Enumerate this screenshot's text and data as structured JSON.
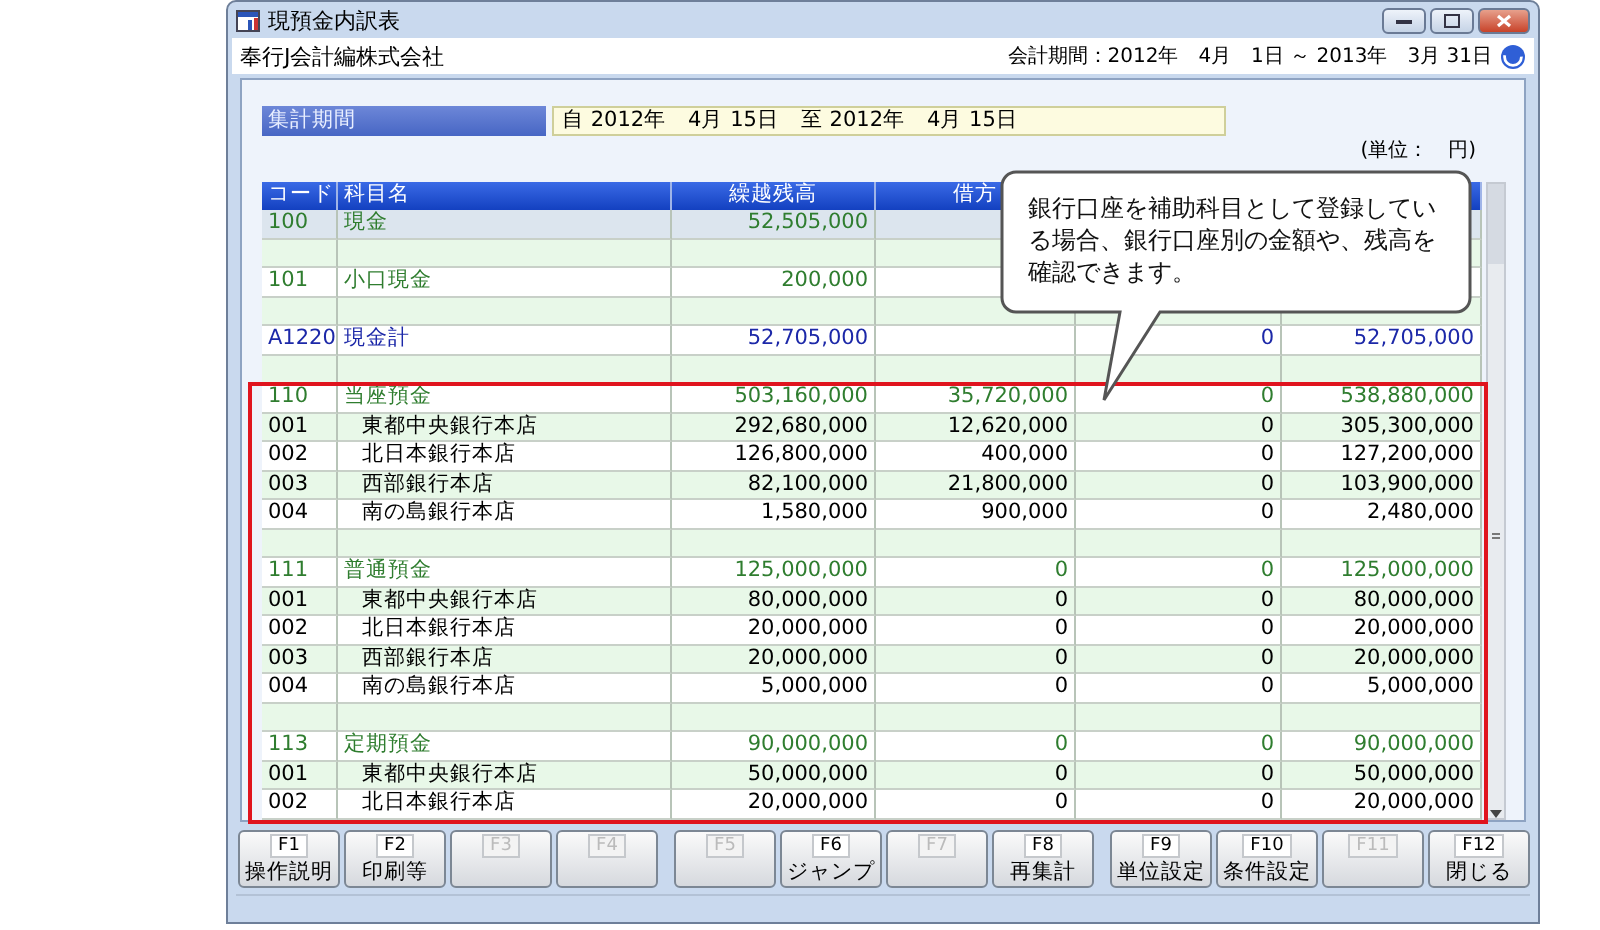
{
  "window": {
    "title": "現預金内訳表",
    "company": "奉行J会計編株式会社",
    "fiscal_period": "会計期間：2012年　4月　1日 ～ 2013年　3月 31日"
  },
  "period": {
    "label": "集計期間",
    "value": "自 2012年　4月 15日　至 2012年　4月 15日"
  },
  "unit": "(単位：　円)",
  "table": {
    "columns": [
      "コード",
      "科目名",
      "繰越残高",
      "借方"
    ],
    "rows": [
      {
        "kind": "group",
        "selected": true,
        "code": "100",
        "name": "現金",
        "carried": "52,505,000"
      },
      {
        "kind": "blank",
        "selected": false
      },
      {
        "kind": "group",
        "selected": false,
        "code": "101",
        "name": "小口現金",
        "carried": "200,000"
      },
      {
        "kind": "blank",
        "selected": false
      },
      {
        "kind": "total",
        "selected": false,
        "code": "A1220",
        "name": "現金計",
        "carried": "52,705,000",
        "credit": "0",
        "balance": "52,705,000"
      },
      {
        "kind": "blank",
        "selected": false
      },
      {
        "kind": "group",
        "selected": false,
        "code": "110",
        "name": "当座預金",
        "carried": "503,160,000",
        "debit": "35,720,000",
        "credit": "0",
        "balance": "538,880,000"
      },
      {
        "kind": "detail",
        "selected": false,
        "code": "001",
        "name": "東都中央銀行本店",
        "carried": "292,680,000",
        "debit": "12,620,000",
        "credit": "0",
        "balance": "305,300,000"
      },
      {
        "kind": "detail",
        "selected": false,
        "code": "002",
        "name": "北日本銀行本店",
        "carried": "126,800,000",
        "debit": "400,000",
        "credit": "0",
        "balance": "127,200,000"
      },
      {
        "kind": "detail",
        "selected": false,
        "code": "003",
        "name": "西部銀行本店",
        "carried": "82,100,000",
        "debit": "21,800,000",
        "credit": "0",
        "balance": "103,900,000"
      },
      {
        "kind": "detail",
        "selected": false,
        "code": "004",
        "name": "南の島銀行本店",
        "carried": "1,580,000",
        "debit": "900,000",
        "credit": "0",
        "balance": "2,480,000"
      },
      {
        "kind": "blank",
        "selected": false
      },
      {
        "kind": "group",
        "selected": false,
        "code": "111",
        "name": "普通預金",
        "carried": "125,000,000",
        "debit": "0",
        "credit": "0",
        "balance": "125,000,000"
      },
      {
        "kind": "detail",
        "selected": false,
        "code": "001",
        "name": "東都中央銀行本店",
        "carried": "80,000,000",
        "debit": "0",
        "credit": "0",
        "balance": "80,000,000"
      },
      {
        "kind": "detail",
        "selected": false,
        "code": "002",
        "name": "北日本銀行本店",
        "carried": "20,000,000",
        "debit": "0",
        "credit": "0",
        "balance": "20,000,000"
      },
      {
        "kind": "detail",
        "selected": false,
        "code": "003",
        "name": "西部銀行本店",
        "carried": "20,000,000",
        "debit": "0",
        "credit": "0",
        "balance": "20,000,000"
      },
      {
        "kind": "detail",
        "selected": false,
        "code": "004",
        "name": "南の島銀行本店",
        "carried": "5,000,000",
        "debit": "0",
        "credit": "0",
        "balance": "5,000,000"
      },
      {
        "kind": "blank",
        "selected": false
      },
      {
        "kind": "group",
        "selected": false,
        "code": "113",
        "name": "定期預金",
        "carried": "90,000,000",
        "debit": "0",
        "credit": "0",
        "balance": "90,000,000"
      },
      {
        "kind": "detail",
        "selected": false,
        "code": "001",
        "name": "東都中央銀行本店",
        "carried": "50,000,000",
        "debit": "0",
        "credit": "0",
        "balance": "50,000,000"
      },
      {
        "kind": "detail",
        "selected": false,
        "code": "002",
        "name": "北日本銀行本店",
        "carried": "20,000,000",
        "debit": "0",
        "credit": "0",
        "balance": "20,000,000"
      }
    ]
  },
  "callout": {
    "text": "銀行口座を補助科目として登録している場合、銀行口座別の金額や、残高を確認できます。"
  },
  "function_keys": [
    {
      "key": "F1",
      "label": "操作説明",
      "disabled": false
    },
    {
      "key": "F2",
      "label": "印刷等",
      "disabled": false
    },
    {
      "key": "F3",
      "disabled": true
    },
    {
      "key": "F4",
      "disabled": true
    },
    {
      "key": "F5",
      "disabled": true
    },
    {
      "key": "F6",
      "label": "ジャンプ",
      "disabled": false
    },
    {
      "key": "F7",
      "disabled": true
    },
    {
      "key": "F8",
      "label": "再集計",
      "disabled": false
    },
    {
      "key": "F9",
      "label": "単位設定",
      "disabled": false
    },
    {
      "key": "F10",
      "label": "条件設定",
      "disabled": false
    },
    {
      "key": "F11",
      "disabled": true
    },
    {
      "key": "F12",
      "label": "閉じる",
      "disabled": false
    }
  ]
}
